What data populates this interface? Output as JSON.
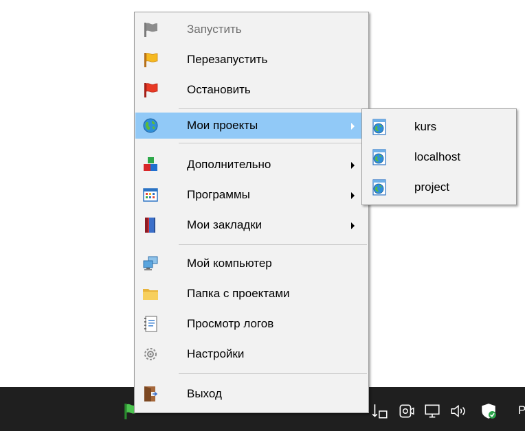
{
  "menu": {
    "items": [
      {
        "label": "Запустить",
        "icon": "gray-flag-icon",
        "disabled": true
      },
      {
        "label": "Перезапустить",
        "icon": "yellow-flag-icon"
      },
      {
        "label": "Остановить",
        "icon": "red-flag-icon"
      },
      {
        "label": "Мои проекты",
        "icon": "globe-icon",
        "highlighted": true,
        "submenu": true
      },
      {
        "label": "Дополнительно",
        "icon": "blocks-icon",
        "submenu": true
      },
      {
        "label": "Программы",
        "icon": "window-grid-icon",
        "submenu": true
      },
      {
        "label": "Мои закладки",
        "icon": "book-icon",
        "submenu": true
      },
      {
        "label": "Мой компьютер",
        "icon": "computer-icon"
      },
      {
        "label": "Папка с проектами",
        "icon": "folder-icon"
      },
      {
        "label": "Просмотр логов",
        "icon": "notepad-icon"
      },
      {
        "label": "Настройки",
        "icon": "gear-icon"
      },
      {
        "label": "Выход",
        "icon": "door-exit-icon"
      }
    ]
  },
  "submenu": {
    "items": [
      {
        "label": "kurs",
        "icon": "web-page-icon"
      },
      {
        "label": "localhost",
        "icon": "web-page-icon"
      },
      {
        "label": "project",
        "icon": "web-page-icon"
      }
    ]
  },
  "taskbar": {
    "clock_partial": "P"
  },
  "colors": {
    "menu_background": "#f2f2f2",
    "highlight": "#91c9f7",
    "taskbar": "#1f1f1f"
  }
}
